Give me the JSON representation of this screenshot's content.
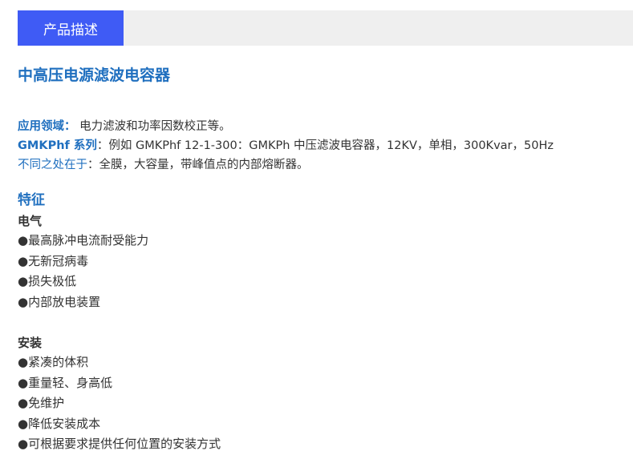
{
  "tab": {
    "label": "产品描述"
  },
  "title": "中高压电源滤波电容器",
  "info": {
    "application_label": "应用领域：",
    "application_value": "电力滤波和功率因数校正等。",
    "series_label": "GMKPhf 系列",
    "series_value": "：例如 GMKPhf 12-1-300：GMKPh 中压滤波电容器，12KV，单相，300Kvar，50Hz",
    "diff_label": "不同之处在于",
    "diff_value": "：全膜，大容量，带峰值点的内部熔断器。"
  },
  "features": {
    "heading": "特征",
    "electrical": {
      "heading": "电气",
      "items": [
        "●最高脉冲电流耐受能力",
        "●无新冠病毒",
        "●损失极低",
        "●内部放电装置"
      ]
    },
    "installation": {
      "heading": "安装",
      "items": [
        "●紧凑的体积",
        "●重量轻、身高低",
        "●免维护",
        "●降低安装成本",
        "●可根据要求提供任何位置的安装方式"
      ]
    }
  },
  "colors": {
    "tab_bg": "#3f5bf5",
    "accent": "#1f6fbf",
    "bar_bg": "#efefef"
  }
}
